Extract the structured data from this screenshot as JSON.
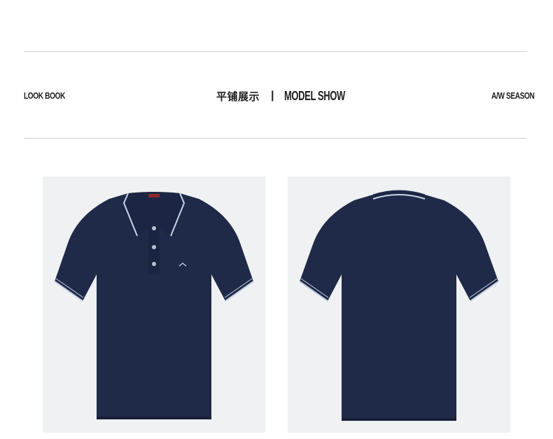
{
  "header": {
    "left_label": "LOOK BOOK",
    "title_zh": "平铺展示",
    "separator": "|",
    "title_en": "MODEL SHOW",
    "right_label": "A/W SEASON"
  },
  "products": [
    {
      "view": "front"
    },
    {
      "view": "back"
    }
  ],
  "colors": {
    "shirt": "#1f2a48",
    "trim": "#c9d4e6",
    "panel_bg": "#eff1f3",
    "rule": "#cfcfcf"
  },
  "icons": [
    "button-icon",
    "logo-icon",
    "brand-label-icon"
  ]
}
